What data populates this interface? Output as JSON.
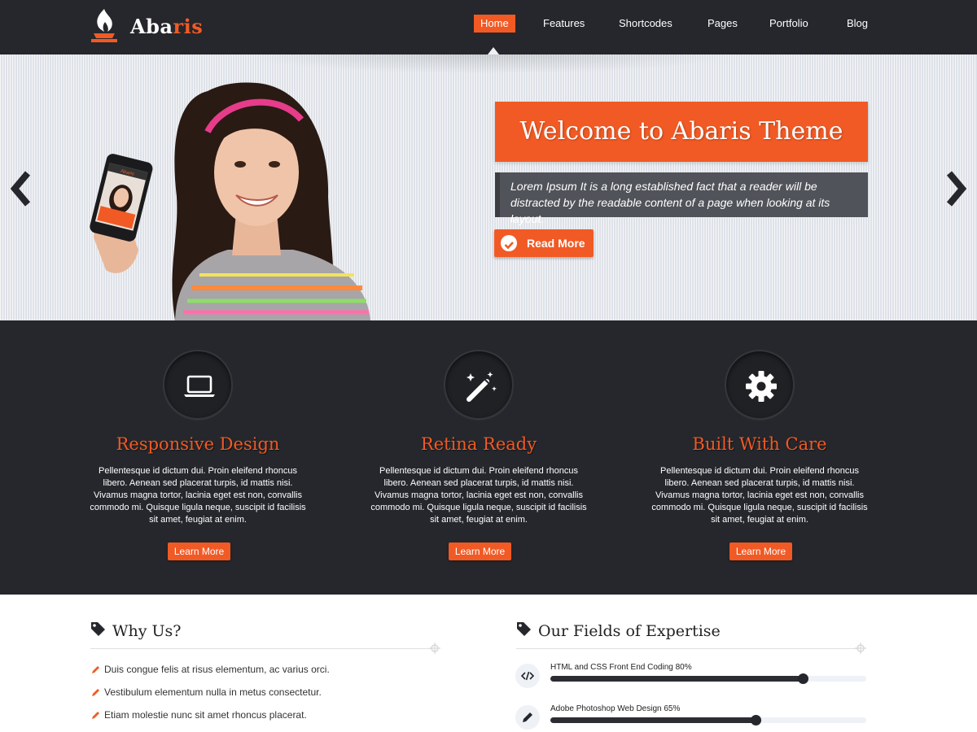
{
  "brand": {
    "name_white": "Aba",
    "name_orange": "ris"
  },
  "nav": {
    "items": [
      "Home",
      "Features",
      "Shortcodes",
      "Pages",
      "Portfolio",
      "Blog"
    ],
    "active": "Home"
  },
  "hero": {
    "title": "Welcome to Abaris Theme",
    "description": "Lorem Ipsum It is a long established fact that a reader will be distracted by the readable content of a page when looking at its layout.",
    "button_label": "Read More",
    "phone_screen_text": "Abaris"
  },
  "features": [
    {
      "icon": "laptop-icon",
      "title": "Responsive Design",
      "text": "Pellentesque id dictum dui. Proin eleifend rhoncus libero. Aenean sed placerat turpis, id mattis nisi. Vivamus magna tortor, lacinia eget est non, convallis commodo mi. Quisque ligula neque, suscipit id facilisis sit amet, feugiat at enim.",
      "button": "Learn More"
    },
    {
      "icon": "magic-wand-icon",
      "title": "Retina Ready",
      "text": "Pellentesque id dictum dui. Proin eleifend rhoncus libero. Aenean sed placerat turpis, id mattis nisi. Vivamus magna tortor, lacinia eget est non, convallis commodo mi. Quisque ligula neque, suscipit id facilisis sit amet, feugiat at enim.",
      "button": "Learn More"
    },
    {
      "icon": "gear-icon",
      "title": "Built With Care",
      "text": "Pellentesque id dictum dui. Proin eleifend rhoncus libero. Aenean sed placerat turpis, id mattis nisi. Vivamus magna tortor, lacinia eget est non, convallis commodo mi. Quisque ligula neque, suscipit id facilisis sit amet, feugiat at enim.",
      "button": "Learn More"
    }
  ],
  "why_us": {
    "title": "Why Us?",
    "items": [
      "Duis congue felis at risus elementum, ac varius orci.",
      "Vestibulum elementum nulla in metus consectetur.",
      "Etiam molestie nunc sit amet rhoncus placerat."
    ]
  },
  "expertise": {
    "title": "Our Fields of Expertise",
    "skills": [
      {
        "label": "HTML and CSS Front End Coding 80%",
        "percent": 80,
        "icon": "code-icon"
      },
      {
        "label": "Adobe Photoshop Web Design 65%",
        "percent": 65,
        "icon": "pencil-icon"
      }
    ]
  },
  "colors": {
    "accent": "#f15a24",
    "dark": "#25272c",
    "panel": "#505359"
  }
}
